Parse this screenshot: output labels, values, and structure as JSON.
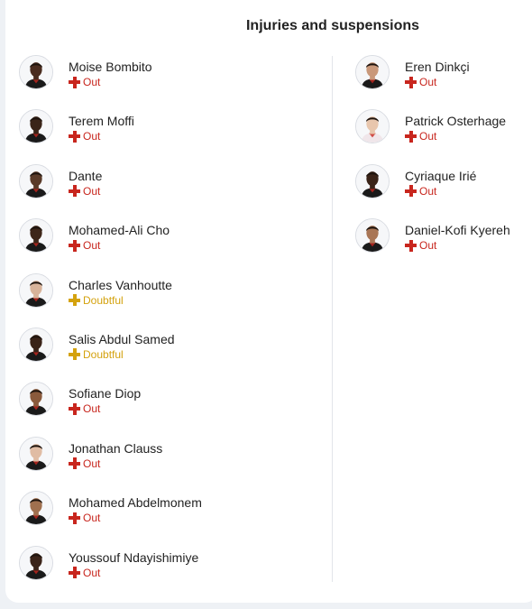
{
  "title": "Injuries and suspensions",
  "colors": {
    "out": "#c8261e",
    "doubtful": "#d4a20e"
  },
  "left": [
    {
      "name": "Moise Bombito",
      "status": "Out",
      "status_type": "out",
      "skin": "#4a2c1f",
      "kit": "#1a1a1a"
    },
    {
      "name": "Terem Moffi",
      "status": "Out",
      "status_type": "out",
      "skin": "#3a2418",
      "kit": "#1a1a1a"
    },
    {
      "name": "Dante",
      "status": "Out",
      "status_type": "out",
      "skin": "#5a3a28",
      "kit": "#1a1a1a"
    },
    {
      "name": "Mohamed-Ali Cho",
      "status": "Out",
      "status_type": "out",
      "skin": "#3e2619",
      "kit": "#1a1a1a"
    },
    {
      "name": "Charles Vanhoutte",
      "status": "Doubtful",
      "status_type": "doubtful",
      "skin": "#d8b39a",
      "kit": "#1a1a1a"
    },
    {
      "name": "Salis Abdul Samed",
      "status": "Doubtful",
      "status_type": "doubtful",
      "skin": "#3a2318",
      "kit": "#1a1a1a"
    },
    {
      "name": "Sofiane Diop",
      "status": "Out",
      "status_type": "out",
      "skin": "#8a5a3c",
      "kit": "#1a1a1a"
    },
    {
      "name": "Jonathan Clauss",
      "status": "Out",
      "status_type": "out",
      "skin": "#e0bca4",
      "kit": "#1a1a1a"
    },
    {
      "name": "Mohamed Abdelmonem",
      "status": "Out",
      "status_type": "out",
      "skin": "#a0704f",
      "kit": "#1a1a1a"
    },
    {
      "name": "Youssouf Ndayishimiye",
      "status": "Out",
      "status_type": "out",
      "skin": "#3b2419",
      "kit": "#1a1a1a"
    }
  ],
  "right": [
    {
      "name": "Eren Dinkçi",
      "status": "Out",
      "status_type": "out",
      "skin": "#c9987a",
      "kit": "#1a1a1a"
    },
    {
      "name": "Patrick Osterhage",
      "status": "Out",
      "status_type": "out",
      "skin": "#e8c6ad",
      "kit": "#f0e6ea"
    },
    {
      "name": "Cyriaque Irié",
      "status": "Out",
      "status_type": "out",
      "skin": "#3a2317",
      "kit": "#1a1a1a"
    },
    {
      "name": "Daniel-Kofi Kyereh",
      "status": "Out",
      "status_type": "out",
      "skin": "#a97656",
      "kit": "#1a1a1a"
    }
  ]
}
